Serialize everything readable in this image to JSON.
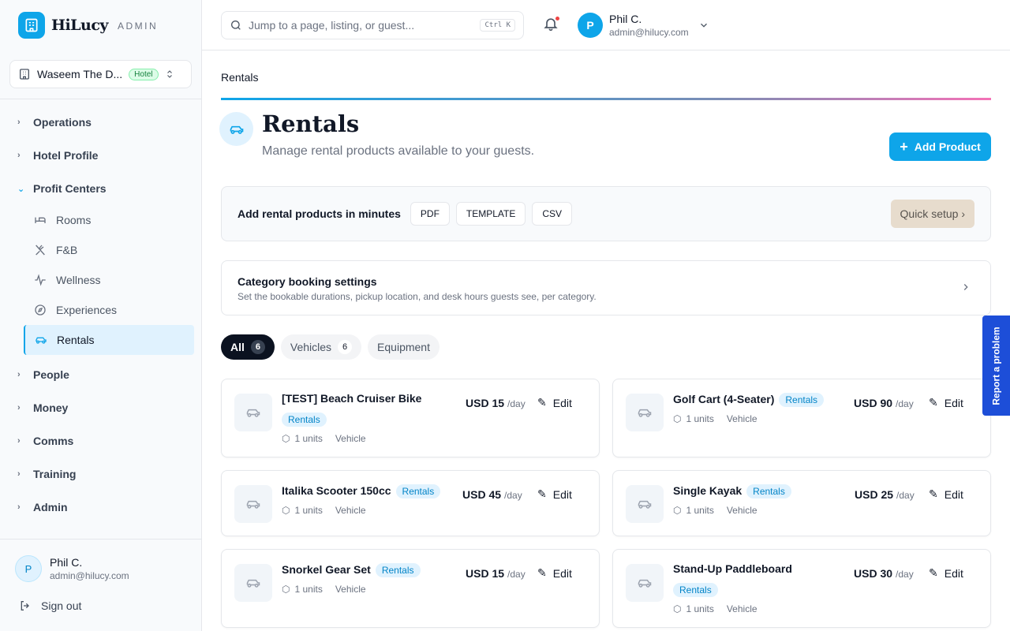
{
  "brand": {
    "name": "HiLucy",
    "suffix": "ADMIN"
  },
  "property": {
    "name": "Waseem The D...",
    "badge": "Hotel"
  },
  "nav": {
    "groups_top": [
      {
        "label": "Operations",
        "expanded": false
      },
      {
        "label": "Hotel Profile",
        "expanded": false
      },
      {
        "label": "Profit Centers",
        "expanded": true
      }
    ],
    "profit_centers": [
      {
        "label": "Rooms",
        "icon": "bed-icon"
      },
      {
        "label": "F&B",
        "icon": "utensils-icon"
      },
      {
        "label": "Wellness",
        "icon": "activity-icon"
      },
      {
        "label": "Experiences",
        "icon": "compass-icon"
      },
      {
        "label": "Rentals",
        "icon": "car-icon",
        "active": true
      }
    ],
    "groups_bottom": [
      {
        "label": "People"
      },
      {
        "label": "Money"
      },
      {
        "label": "Comms"
      },
      {
        "label": "Training"
      },
      {
        "label": "Admin"
      }
    ]
  },
  "sidebar_user": {
    "initial": "P",
    "name": "Phil C.",
    "email": "admin@hilucy.com",
    "signout": "Sign out"
  },
  "topbar": {
    "search_placeholder": "Jump to a page, listing, or guest...",
    "shortcut": "Ctrl K",
    "user": {
      "initial": "P",
      "name": "Phil C.",
      "email": "admin@hilucy.com"
    }
  },
  "page": {
    "breadcrumb": "Rentals",
    "title": "Rentals",
    "subtitle": "Manage rental products available to your guests.",
    "add_button": "Add Product"
  },
  "quick": {
    "text": "Add rental products in minutes",
    "buttons": [
      "PDF",
      "TEMPLATE",
      "CSV"
    ],
    "setup": "Quick setup ›"
  },
  "category": {
    "title": "Category booking settings",
    "subtitle": "Set the bookable durations, pickup location, and desk hours guests see, per category."
  },
  "tabs": [
    {
      "label": "All",
      "count": "6",
      "active": true
    },
    {
      "label": "Vehicles",
      "count": "6"
    },
    {
      "label": "Equipment",
      "count": ""
    }
  ],
  "products": [
    {
      "name": "[TEST] Beach Cruiser Bike",
      "badge": "Rentals",
      "units": "1 units",
      "type": "Vehicle",
      "price": "USD 15",
      "per": "/day",
      "edit": "Edit",
      "badge_below": true
    },
    {
      "name": "Golf Cart (4-Seater)",
      "badge": "Rentals",
      "units": "1 units",
      "type": "Vehicle",
      "price": "USD 90",
      "per": "/day",
      "edit": "Edit",
      "badge_below": false
    },
    {
      "name": "Italika Scooter 150cc",
      "badge": "Rentals",
      "units": "1 units",
      "type": "Vehicle",
      "price": "USD 45",
      "per": "/day",
      "edit": "Edit",
      "badge_below": false
    },
    {
      "name": "Single Kayak",
      "badge": "Rentals",
      "units": "1 units",
      "type": "Vehicle",
      "price": "USD 25",
      "per": "/day",
      "edit": "Edit",
      "badge_below": false
    },
    {
      "name": "Snorkel Gear Set",
      "badge": "Rentals",
      "units": "1 units",
      "type": "Vehicle",
      "price": "USD 15",
      "per": "/day",
      "edit": "Edit",
      "badge_below": false
    },
    {
      "name": "Stand-Up Paddleboard",
      "badge": "Rentals",
      "units": "1 units",
      "type": "Vehicle",
      "price": "USD 30",
      "per": "/day",
      "edit": "Edit",
      "badge_below": true
    }
  ],
  "report": "Report a problem",
  "colors": {
    "accent": "#0ea5e9",
    "badge_bg": "#e0f2fe",
    "report_bg": "#1d4ed8",
    "quick_setup_bg": "#e7dccd"
  }
}
